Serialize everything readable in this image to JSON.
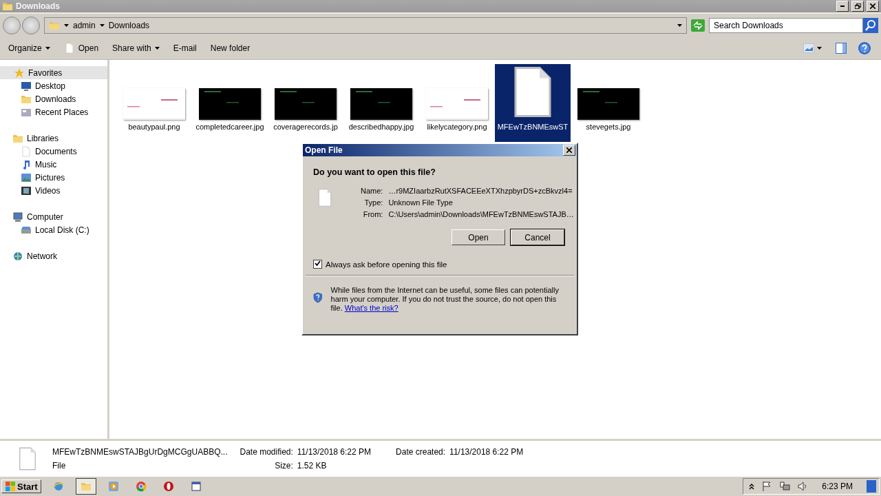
{
  "window": {
    "title": "Downloads"
  },
  "address": {
    "crumbs": [
      "admin",
      "Downloads"
    ]
  },
  "search": {
    "placeholder": "Search Downloads"
  },
  "toolbar": [
    {
      "label": "Organize",
      "kind": "dropdown"
    },
    {
      "label": "Open",
      "kind": "file"
    },
    {
      "label": "Share with",
      "kind": "dropdown"
    },
    {
      "label": "E-mail",
      "kind": "plain"
    },
    {
      "label": "New folder",
      "kind": "plain"
    }
  ],
  "sidebar": [
    {
      "label": "Favorites",
      "kind": "star",
      "children": [
        {
          "label": "Desktop",
          "kind": "desktop"
        },
        {
          "label": "Downloads",
          "kind": "downloads"
        },
        {
          "label": "Recent Places",
          "kind": "recent"
        }
      ]
    },
    {
      "label": "Libraries",
      "kind": "library",
      "children": [
        {
          "label": "Documents",
          "kind": "documents"
        },
        {
          "label": "Music",
          "kind": "music"
        },
        {
          "label": "Pictures",
          "kind": "pictures"
        },
        {
          "label": "Videos",
          "kind": "videos"
        }
      ]
    },
    {
      "label": "Computer",
      "kind": "computer",
      "children": [
        {
          "label": "Local Disk (C:)",
          "kind": "disk"
        }
      ]
    },
    {
      "label": "Network",
      "kind": "network"
    }
  ],
  "files": [
    {
      "name": "beautypaul.png",
      "kind": "picture",
      "color": "#ffffff",
      "selected": false
    },
    {
      "name": "completedcareer.jpg",
      "kind": "picture",
      "color": "#000000",
      "selected": false
    },
    {
      "name": "coveragerecords.jp",
      "kind": "picture",
      "color": "#000000",
      "selected": false
    },
    {
      "name": "describedhappy.jpg",
      "kind": "picture",
      "color": "#000000",
      "selected": false
    },
    {
      "name": "likelycategory.png",
      "kind": "picture",
      "color": "#ffffff",
      "selected": false
    },
    {
      "name": "MFEwTzBNMEswST",
      "kind": "document",
      "selected": true
    },
    {
      "name": "stevegets.jpg",
      "kind": "picture",
      "color": "#000000",
      "selected": false
    }
  ],
  "dialog": {
    "title": "Open File",
    "question": "Do you want to open this file?",
    "fields": [
      {
        "label": "Name:",
        "value": "…r9MZIaarbzRutXSFACEEeXTXhzpbyrDS+zcBkvzl4="
      },
      {
        "label": "Type:",
        "value": "Unknown File Type"
      },
      {
        "label": "From:",
        "value": "C:\\Users\\admin\\Downloads\\MFEwTzBNMEswSTAJB…"
      }
    ],
    "buttons": [
      {
        "label": "Open",
        "selected": false
      },
      {
        "label": "Cancel",
        "selected": true
      }
    ],
    "checkbox": {
      "label": "Always ask before opening this file",
      "checked": true
    },
    "warning": "While files from the Internet can be useful, some files can potentially harm your computer. If you do not trust the source, do not open this file.",
    "link": "What's the risk?"
  },
  "details": {
    "name": "MFEwTzBNMEswSTAJBgUrDgMCGgUABBQ...",
    "type": "File",
    "props": [
      {
        "label": "Date modified:",
        "value": "11/13/2018 6:22 PM"
      },
      {
        "label": "Date created:",
        "value": "11/13/2018 6:22 PM"
      },
      {
        "label": "Size:",
        "value": "1.52 KB"
      }
    ]
  },
  "taskbar": {
    "start": "Start",
    "apps": [
      {
        "kind": "browser",
        "selected": false
      },
      {
        "kind": "folder",
        "selected": true
      },
      {
        "kind": "media",
        "selected": false
      },
      {
        "kind": "chrome",
        "selected": false
      },
      {
        "kind": "opera",
        "selected": false
      },
      {
        "kind": "window",
        "selected": false
      }
    ],
    "time": "6:23 PM"
  }
}
